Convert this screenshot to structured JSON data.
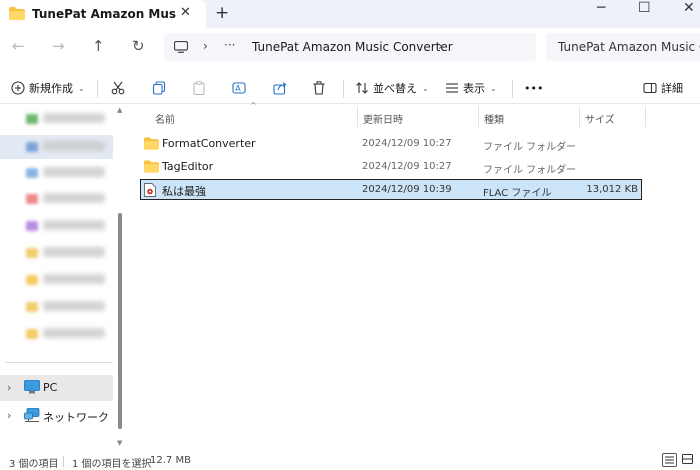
{
  "window": {
    "tab_title": "TunePat Amazon Music Converter",
    "tab_close": "✕",
    "new_tab": "+",
    "minimize": "─",
    "maximize": "☐",
    "close": "✕"
  },
  "nav": {
    "back": "←",
    "forward": "→",
    "up": "↑",
    "refresh": "↻"
  },
  "address": {
    "sep1": "›",
    "more": "···",
    "crumb": "TunePat Amazon Music Converter",
    "sep2": "›"
  },
  "search": {
    "value": "TunePat Amazon Music Converter"
  },
  "toolbar": {
    "new_label": "新規作成",
    "sort_label": "並べ替え",
    "view_label": "表示",
    "more": "•••",
    "details_label": "詳細",
    "caret": "⌄"
  },
  "sidebar": {
    "expand": "›",
    "pc_label": "PC",
    "network_label": "ネットワーク"
  },
  "columns": {
    "sort_indicator": "^",
    "name": "名前",
    "date": "更新日時",
    "type": "種類",
    "size": "サイズ"
  },
  "files": [
    {
      "name": "FormatConverter",
      "date": "2024/12/09 10:27",
      "type": "ファイル フォルダー",
      "size": "",
      "icon": "folder-icon"
    },
    {
      "name": "TagEditor",
      "date": "2024/12/09 10:27",
      "type": "ファイル フォルダー",
      "size": "",
      "icon": "folder-icon"
    },
    {
      "name": "私は最強",
      "date": "2024/12/09 10:39",
      "type": "FLAC ファイル",
      "size": "13,012 KB",
      "icon": "audio-file-icon"
    }
  ],
  "status": {
    "item_count": "3 個の項目",
    "selection": "1 個の項目を選択",
    "selected_size": "12.7 MB"
  },
  "colors": {
    "accent": "#0067c0",
    "selection_fill": "#cce4f7",
    "folder": "#f6c342",
    "tabbar": "#eef2f8"
  }
}
